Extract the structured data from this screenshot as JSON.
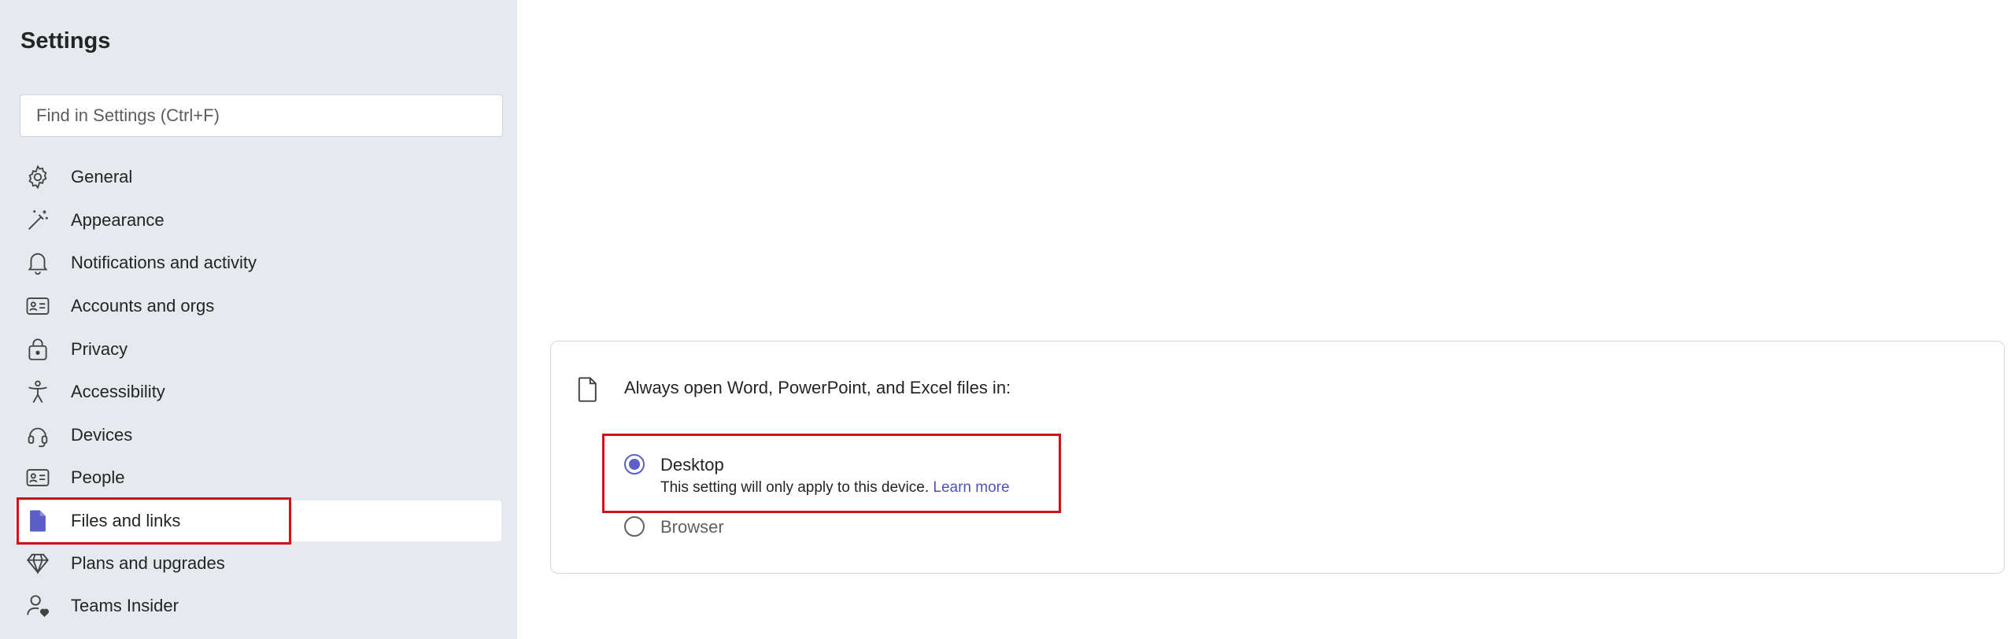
{
  "sidebar": {
    "title": "Settings",
    "search_placeholder": "Find in Settings (Ctrl+F)",
    "items": [
      {
        "label": "General",
        "icon": "gear-icon"
      },
      {
        "label": "Appearance",
        "icon": "magic-wand-icon"
      },
      {
        "label": "Notifications and activity",
        "icon": "bell-icon"
      },
      {
        "label": "Accounts and orgs",
        "icon": "id-card-icon"
      },
      {
        "label": "Privacy",
        "icon": "lock-icon"
      },
      {
        "label": "Accessibility",
        "icon": "accessibility-icon"
      },
      {
        "label": "Devices",
        "icon": "headset-icon"
      },
      {
        "label": "People",
        "icon": "contact-card-icon"
      },
      {
        "label": "Files and links",
        "icon": "document-icon",
        "selected": true
      },
      {
        "label": "Plans and upgrades",
        "icon": "diamond-icon"
      },
      {
        "label": "Teams Insider",
        "icon": "person-heart-icon"
      }
    ]
  },
  "files_card": {
    "title": "Always open Word, PowerPoint, and Excel files in:",
    "options": [
      {
        "label": "Desktop",
        "checked": true
      },
      {
        "label": "Browser",
        "checked": false
      }
    ],
    "desktop_description": "This setting will only apply to this device.",
    "learn_more": "Learn more"
  },
  "colors": {
    "accent": "#5b5fc7",
    "highlight": "#d0121b",
    "sidebar_bg": "#e6e9ee"
  }
}
